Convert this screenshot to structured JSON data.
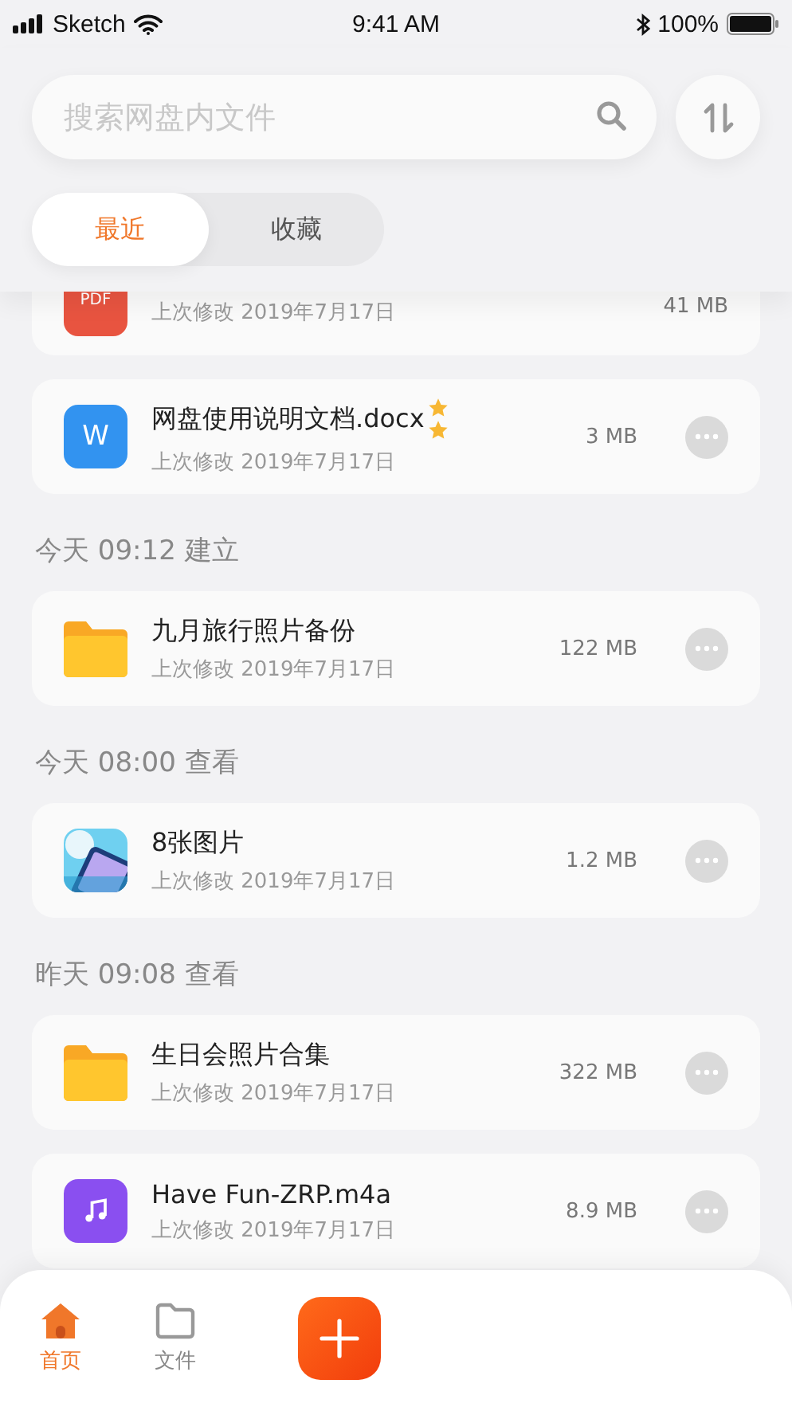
{
  "status_bar": {
    "carrier": "Sketch",
    "time": "9:41 AM",
    "battery": "100%"
  },
  "search": {
    "placeholder": "搜索网盘内文件"
  },
  "tabs": [
    {
      "label": "最近",
      "selected": true
    },
    {
      "label": "收藏",
      "selected": false
    }
  ],
  "list": [
    {
      "kind": "pdf",
      "icon_text": "PDF",
      "meta": "上次修改 2019年7月17日",
      "size": "41 MB"
    },
    {
      "kind": "word",
      "icon_text": "W",
      "name": "网盘使用说明文档.docx",
      "meta": "上次修改 2019年7月17日",
      "size": "3 MB",
      "favorite": true
    },
    {
      "kind": "section",
      "label": "今天 09:12 建立"
    },
    {
      "kind": "folder",
      "name": "九月旅行照片备份",
      "meta": "上次修改 2019年7月17日",
      "size": "122 MB"
    },
    {
      "kind": "section",
      "label": "今天 08:00 查看"
    },
    {
      "kind": "picture",
      "name": "8张图片",
      "meta": "上次修改 2019年7月17日",
      "size": "1.2 MB"
    },
    {
      "kind": "section",
      "label": "昨天 09:08 查看"
    },
    {
      "kind": "folder",
      "name": "生日会照片合集",
      "meta": "上次修改 2019年7月17日",
      "size": "322 MB"
    },
    {
      "kind": "music",
      "name": "Have Fun-ZRP.m4a",
      "meta": "上次修改 2019年7月17日",
      "size": "8.9 MB"
    }
  ],
  "tab_bar": [
    {
      "kind": "home",
      "label": "首页",
      "selected": true
    },
    {
      "kind": "files",
      "label": "文件",
      "selected": false
    },
    {
      "kind": "add"
    }
  ]
}
